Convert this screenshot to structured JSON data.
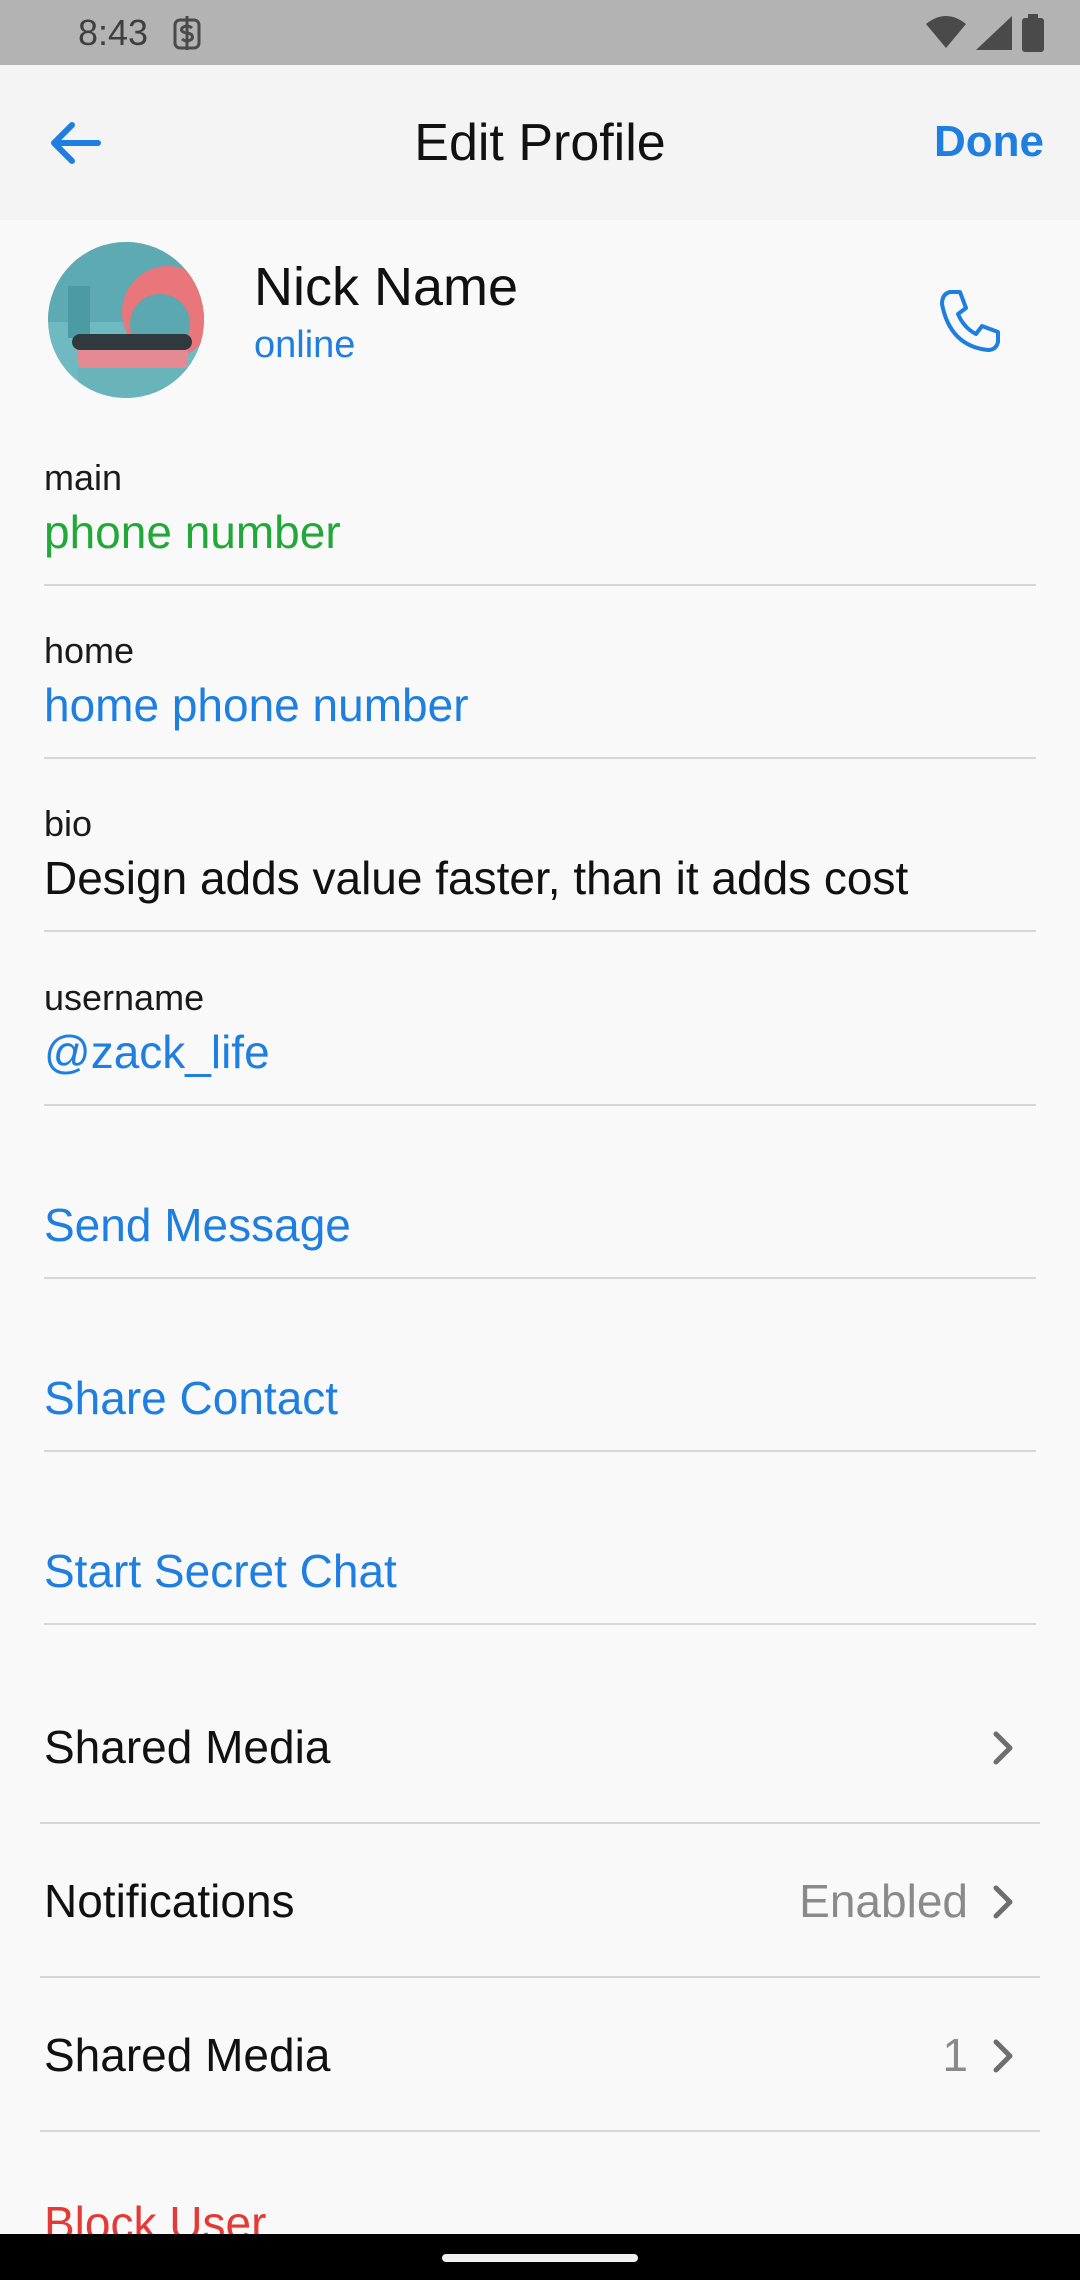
{
  "status_bar": {
    "time": "8:43"
  },
  "header": {
    "title": "Edit Profile",
    "done_label": "Done"
  },
  "profile": {
    "name": "Nick Name",
    "status": "online"
  },
  "fields": [
    {
      "label": "main",
      "value": "phone number",
      "color": "#22a839"
    },
    {
      "label": "home",
      "value": "home phone number",
      "color": "#1e7fe0"
    },
    {
      "label": "bio",
      "value": "Design adds value faster, than it adds cost",
      "color": "#111111"
    },
    {
      "label": "username",
      "value": "@zack_life",
      "color": "#1e7fe0"
    }
  ],
  "actions": [
    {
      "label": "Send Message"
    },
    {
      "label": "Share Contact"
    },
    {
      "label": "Start Secret Chat"
    }
  ],
  "rows": [
    {
      "label": "Shared Media",
      "value": ""
    },
    {
      "label": "Notifications",
      "value": "Enabled"
    },
    {
      "label": "Shared Media",
      "value": "1"
    }
  ],
  "block_user_label": "Block User",
  "colors": {
    "accent": "#1e7fe0",
    "green": "#22a839",
    "danger": "#e53935"
  },
  "icons": {
    "back": "arrow-left-icon",
    "call": "phone-icon",
    "chevron": "chevron-right-icon"
  }
}
